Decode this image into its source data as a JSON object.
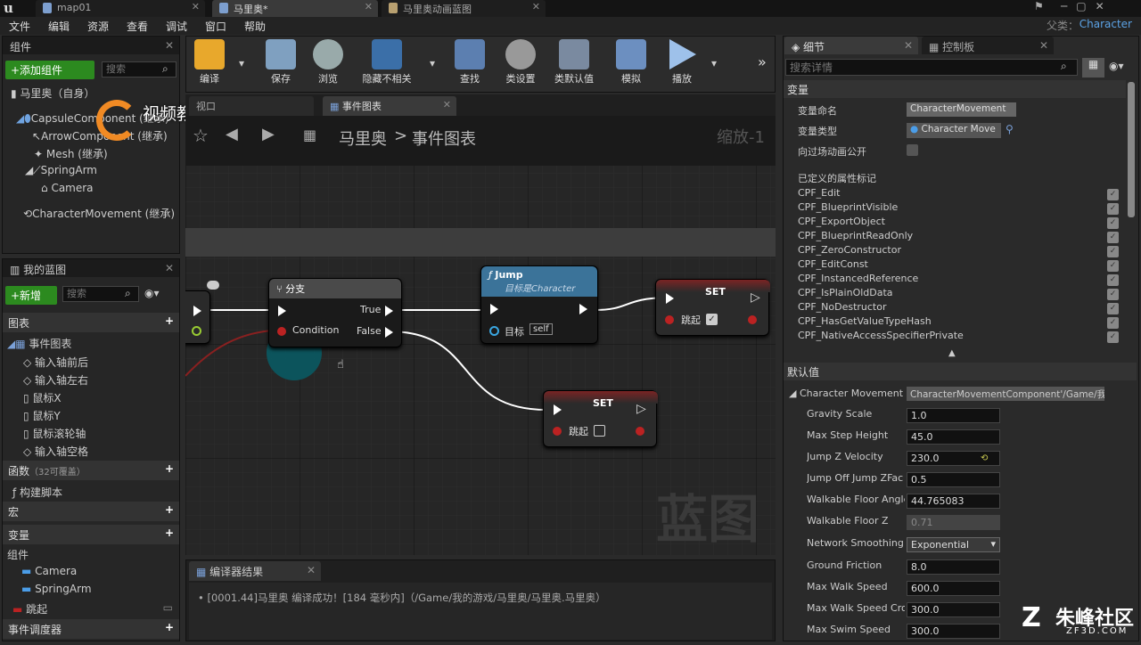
{
  "titlebar": {
    "tabs": [
      {
        "label": "map01"
      },
      {
        "label": "马里奥*"
      },
      {
        "label": "马里奥动画蓝图"
      }
    ],
    "parent_label": "父类：",
    "parent_value": "Character"
  },
  "menu": [
    "文件",
    "编辑",
    "资源",
    "查看",
    "调试",
    "窗口",
    "帮助"
  ],
  "components_panel": {
    "title": "组件",
    "add_button": "+添加组件",
    "search_placeholder": "搜索",
    "root": "马里奥（自身）",
    "items": [
      {
        "label": "CapsuleComponent (继承)"
      },
      {
        "label": "ArrowComponent (继承)"
      },
      {
        "label": "Mesh (继承)"
      },
      {
        "label": "SpringArm"
      },
      {
        "label": "Camera"
      },
      {
        "label": "CharacterMovement (继承)"
      }
    ]
  },
  "watermark_left": "视频教程社区",
  "blueprint_panel": {
    "title": "我的蓝图",
    "new_button": "+新增",
    "search_placeholder": "搜索",
    "graphs_label": "图表",
    "event_graph": "事件图表",
    "events": [
      "输入轴前后",
      "输入轴左右",
      "鼠标X",
      "鼠标Y",
      "鼠标滚轮轴",
      "输入轴空格"
    ],
    "functions_label": "函数",
    "functions_note": "（32可覆盖）",
    "construct_script": "构建脚本",
    "macros_label": "宏",
    "variables_label": "变量",
    "components_label": "组件",
    "vars": [
      "Camera",
      "SpringArm"
    ],
    "jump_var": "跳起",
    "dispatchers_label": "事件调度器"
  },
  "toolbar": {
    "buttons": [
      "编译",
      "保存",
      "浏览",
      "隐藏不相关",
      "查找",
      "类设置",
      "类默认值",
      "模拟",
      "播放"
    ]
  },
  "graph_tabs": {
    "viewport": "视口",
    "event_graph": "事件图表"
  },
  "breadcrumb": {
    "root": "马里奥",
    "sep": ">",
    "current": "事件图表",
    "zoom": "缩放-1"
  },
  "nodes": {
    "branch_title": "分支",
    "branch_condition": "Condition",
    "branch_true": "True",
    "branch_false": "False",
    "jump_title": "Jump",
    "jump_sub": "目标是Character",
    "jump_target": "目标",
    "jump_self": "self",
    "set_title": "SET",
    "set_label": "跳起"
  },
  "graph_watermark": "蓝图",
  "compiler": {
    "title": "编译器结果",
    "message": "[0001.44]马里奥 编译成功！[184 毫秒内]（/Game/我的游戏/马里奥/马里奥.马里奥）"
  },
  "details": {
    "tab_details": "细节",
    "tab_control": "控制板",
    "search_placeholder": "搜索详情",
    "variables_section": "变量",
    "var_name_label": "变量命名",
    "var_name": "CharacterMovement",
    "var_type_label": "变量类型",
    "var_type": "Character Move",
    "expose_label": "向过场动画公开",
    "flags_label": "已定义的属性标记",
    "flags": [
      "CPF_Edit",
      "CPF_BlueprintVisible",
      "CPF_ExportObject",
      "CPF_BlueprintReadOnly",
      "CPF_ZeroConstructor",
      "CPF_EditConst",
      "CPF_InstancedReference",
      "CPF_IsPlainOldData",
      "CPF_NoDestructor",
      "CPF_HasGetValueTypeHash",
      "CPF_NativeAccessSpecifierPrivate"
    ],
    "defaults_section": "默认值",
    "cm_label": "Character Movement",
    "cm_value": "CharacterMovementComponent'/Game/我",
    "props": [
      {
        "label": "Gravity Scale",
        "value": "1.0"
      },
      {
        "label": "Max Step Height",
        "value": "45.0"
      },
      {
        "label": "Jump Z Velocity",
        "value": "230.0"
      },
      {
        "label": "Jump Off Jump ZFac",
        "value": "0.5"
      },
      {
        "label": "Walkable Floor Angle",
        "value": "44.765083"
      },
      {
        "label": "Walkable Floor Z",
        "value": "0.71"
      },
      {
        "label": "Network Smoothing M",
        "value": "Exponential"
      },
      {
        "label": "Ground Friction",
        "value": "8.0"
      },
      {
        "label": "Max Walk Speed",
        "value": "600.0"
      },
      {
        "label": "Max Walk Speed Crou",
        "value": "300.0"
      },
      {
        "label": "Max Swim Speed",
        "value": "300.0"
      }
    ]
  },
  "watermark_right": "朱峰社区",
  "watermark_right_sub": "ZF3D.COM"
}
